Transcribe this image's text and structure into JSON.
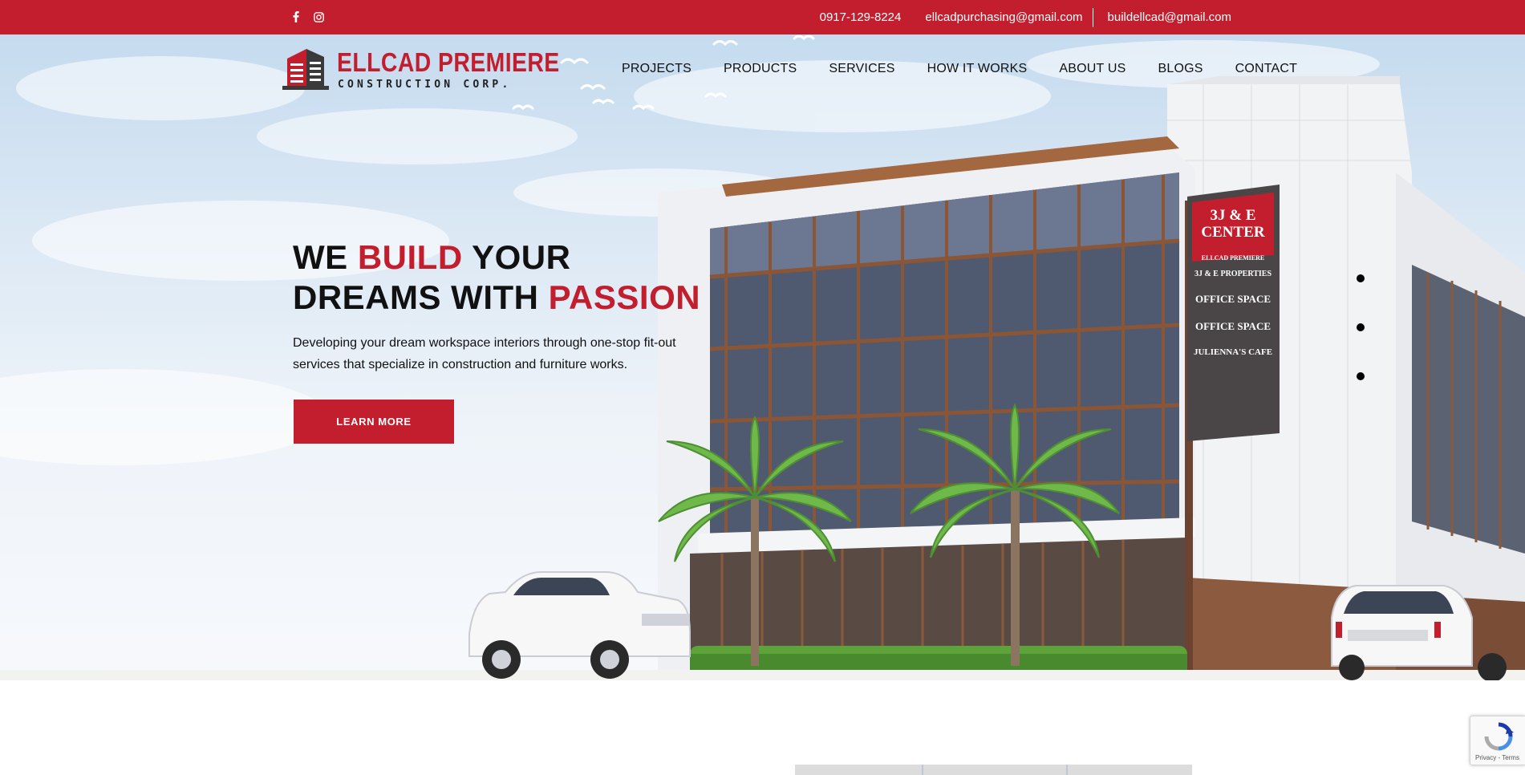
{
  "topbar": {
    "social_icons": [
      "facebook-icon",
      "instagram-icon"
    ],
    "phone": "0917-129-8224",
    "email_1": "ellcadpurchasing@gmail.com",
    "email_2": "buildellcad@gmail.com"
  },
  "logo": {
    "name": "ELLCAD PREMIERE",
    "subtitle": "CONSTRUCTION CORP."
  },
  "nav": {
    "items": [
      "PROJECTS",
      "PRODUCTS",
      "SERVICES",
      "HOW IT WORKS",
      "ABOUT US",
      "BLOGS",
      "CONTACT"
    ]
  },
  "hero": {
    "line1_a": "WE ",
    "line1_red": "BUILD",
    "line1_b": " YOUR",
    "line2_a": "DREAMS WITH ",
    "line2_red": "PASSION",
    "lead": "Developing your dream workspace interiors through one-stop fit-out services that specialize in construction and furniture works.",
    "button": "LEARN MORE",
    "sign": {
      "title_1": "3J & E",
      "title_2": "CENTER",
      "rows": [
        "ELLCAD PREMIERE",
        "3J & E PROPERTIES",
        "OFFICE SPACE",
        "OFFICE SPACE",
        "JULIENNA'S CAFE"
      ]
    },
    "slider_dots": 3
  },
  "recaptcha": {
    "terms": "Privacy - Terms"
  },
  "colors": {
    "brand_red": "#c31e2e",
    "text": "#111111"
  }
}
